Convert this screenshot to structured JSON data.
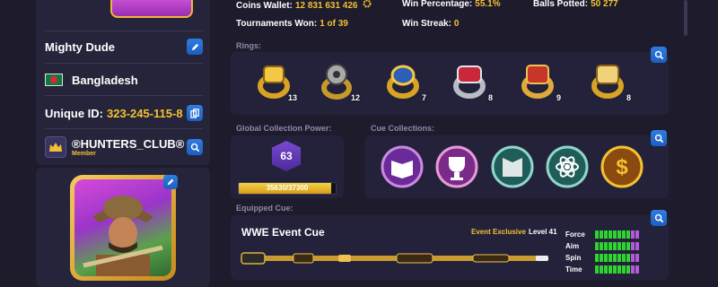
{
  "profile": {
    "name": "Mighty Dude",
    "country": "Bangladesh",
    "unique_id_label": "Unique ID:",
    "unique_id": "323-245-115-8",
    "club_name": "®HUNTERS_CLUB®",
    "club_role": "Member"
  },
  "stats": {
    "coins_label": "Coins Wallet:",
    "coins": "12 831 631 426",
    "win_pct_label": "Win Percentage:",
    "win_pct": "55.1%",
    "balls_label": "Balls Potted:",
    "balls": "50 277",
    "tournaments_label": "Tournaments Won:",
    "tournaments": "1 of 39",
    "streak_label": "Win Streak:",
    "streak": "0"
  },
  "rings": {
    "label": "Rings:",
    "items": [
      {
        "icon": "gold-ring-icon",
        "count": "13"
      },
      {
        "icon": "film-ring-icon",
        "count": "12"
      },
      {
        "icon": "blue-gem-ring-icon",
        "count": "7"
      },
      {
        "icon": "red-silver-ring-icon",
        "count": "8"
      },
      {
        "icon": "red-gold-ring-icon",
        "count": "9"
      },
      {
        "icon": "ornate-gold-ring-icon",
        "count": "8"
      }
    ]
  },
  "collection_power": {
    "label": "Global Collection Power:",
    "level": "63",
    "progress_text": "35630/37300",
    "progress": 0.955
  },
  "cue_collections": {
    "label": "Cue Collections:",
    "items": [
      "book-collection-icon",
      "trophy-collection-icon",
      "karate-collection-icon",
      "atom-collection-icon",
      "dollar-collection-icon"
    ]
  },
  "equipped_cue": {
    "label": "Equipped Cue:",
    "name": "WWE Event Cue",
    "tag": "Event Exclusive",
    "level": "Level 41",
    "attributes": [
      {
        "name": "Force",
        "filled": 8,
        "extra": 2
      },
      {
        "name": "Aim",
        "filled": 8,
        "extra": 2
      },
      {
        "name": "Spin",
        "filled": 8,
        "extra": 2
      },
      {
        "name": "Time",
        "filled": 8,
        "extra": 2
      }
    ]
  },
  "colors": {
    "accent_gold": "#f2c230",
    "button_blue": "#2f7ce0",
    "bar_green": "#2fd52f",
    "bar_purple": "#b25ad9"
  }
}
